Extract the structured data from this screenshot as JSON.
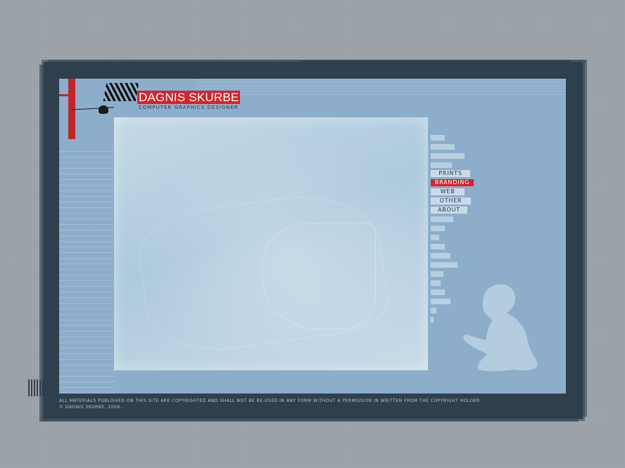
{
  "site": {
    "name": "DAGNIS SKURBE",
    "tagline": "COMPUTER GRAPHICS DESIGNER"
  },
  "nav": {
    "items": [
      {
        "label": "PRINTS",
        "active": false
      },
      {
        "label": "BRANDING",
        "active": true
      },
      {
        "label": "WEB",
        "active": false
      },
      {
        "label": "OTHER",
        "active": false
      },
      {
        "label": "ABOUT",
        "active": false
      }
    ]
  },
  "footer": {
    "copyright_notice": "ALL MATERIALS PUBLISHED ON THIS SITE ARE COPYRIGHTED AND SHALL NOT BE RE-USED IN ANY FORM WITHOUT A PERMISSION IN WRITTEN FROM THE COPYRIGHT HOLDER.",
    "copyright_line": "© DAGNIS SKURBE, 2006."
  },
  "colors": {
    "accent": "#d3252b",
    "frame": "#2e3f4e",
    "panel": "#8daecb",
    "page_background": "#9ba2a8"
  },
  "icons": [
    "brush-stroke-icon",
    "pin-icon",
    "child-silhouette-icon"
  ]
}
